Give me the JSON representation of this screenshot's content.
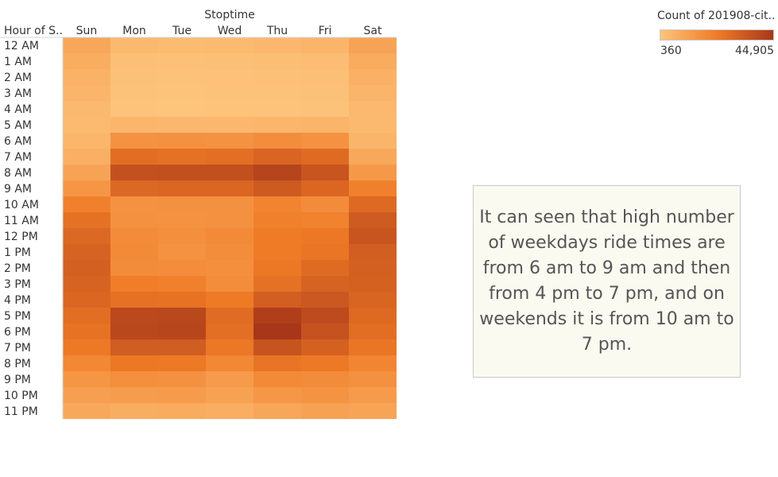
{
  "chart_data": {
    "type": "heatmap",
    "title": "",
    "column_group_label": "Stoptime",
    "row_header": "Hour of S..",
    "x": [
      "Sun",
      "Mon",
      "Tue",
      "Wed",
      "Thu",
      "Fri",
      "Sat"
    ],
    "y": [
      "12 AM",
      "1 AM",
      "2 AM",
      "3 AM",
      "4 AM",
      "5 AM",
      "6 AM",
      "7 AM",
      "8 AM",
      "9 AM",
      "10 AM",
      "11 AM",
      "12 PM",
      "1 PM",
      "2 PM",
      "3 PM",
      "4 PM",
      "5 PM",
      "6 PM",
      "7 PM",
      "8 PM",
      "9 PM",
      "10 PM",
      "11 PM"
    ],
    "values": [
      [
        9500,
        3600,
        3100,
        3400,
        4200,
        4800,
        10500
      ],
      [
        7500,
        2000,
        1700,
        1900,
        2500,
        2800,
        8000
      ],
      [
        6000,
        1300,
        1100,
        1200,
        1600,
        1900,
        6300
      ],
      [
        4800,
        900,
        800,
        850,
        1100,
        1300,
        5000
      ],
      [
        3800,
        700,
        360,
        650,
        800,
        1000,
        4000
      ],
      [
        3500,
        4500,
        4200,
        4300,
        4500,
        5000,
        3600
      ],
      [
        4500,
        15500,
        16000,
        15500,
        17000,
        15500,
        5000
      ],
      [
        6500,
        27000,
        26000,
        26500,
        30000,
        28000,
        9000
      ],
      [
        10500,
        36500,
        37000,
        37000,
        40500,
        35000,
        13500
      ],
      [
        14500,
        29000,
        29500,
        29500,
        33500,
        29500,
        21000
      ],
      [
        21000,
        15500,
        16000,
        16000,
        20000,
        17500,
        28500
      ],
      [
        26000,
        16000,
        15500,
        16000,
        21000,
        20500,
        33000
      ],
      [
        29000,
        17500,
        16500,
        18000,
        22500,
        24000,
        35000
      ],
      [
        30500,
        18000,
        15500,
        17000,
        22500,
        24500,
        32000
      ],
      [
        31500,
        17500,
        17000,
        16500,
        24000,
        28000,
        31500
      ],
      [
        30500,
        22000,
        21000,
        17000,
        26000,
        30500,
        31000
      ],
      [
        29500,
        26000,
        25500,
        23000,
        32000,
        34000,
        30000
      ],
      [
        27000,
        39000,
        39500,
        27500,
        42500,
        38500,
        28500
      ],
      [
        25500,
        39500,
        40000,
        26500,
        44905,
        36000,
        27000
      ],
      [
        23500,
        32500,
        32500,
        24000,
        35500,
        31000,
        24500
      ],
      [
        19000,
        24000,
        23500,
        19000,
        25000,
        23500,
        19500
      ],
      [
        14500,
        16500,
        16000,
        13000,
        18000,
        17500,
        16000
      ],
      [
        11500,
        12500,
        13000,
        11000,
        14000,
        15000,
        13000
      ],
      [
        9000,
        7500,
        8000,
        7000,
        9500,
        11000,
        10000
      ]
    ],
    "color_scale": {
      "min": 360,
      "max": 44905,
      "low_color": "#fdc47c",
      "mid_color": "#f07b26",
      "high_color": "#a8371a"
    },
    "legend": {
      "title": "Count of 201908-cit..",
      "min_label": "360",
      "max_label": "44,905",
      "position": "top-right"
    },
    "grid": false
  },
  "annotation": {
    "text": "It can seen that high number of weekdays ride times are from 6 am to 9 am and then from 4 pm to 7 pm, and on weekends it is from 10 am to 7 pm."
  }
}
